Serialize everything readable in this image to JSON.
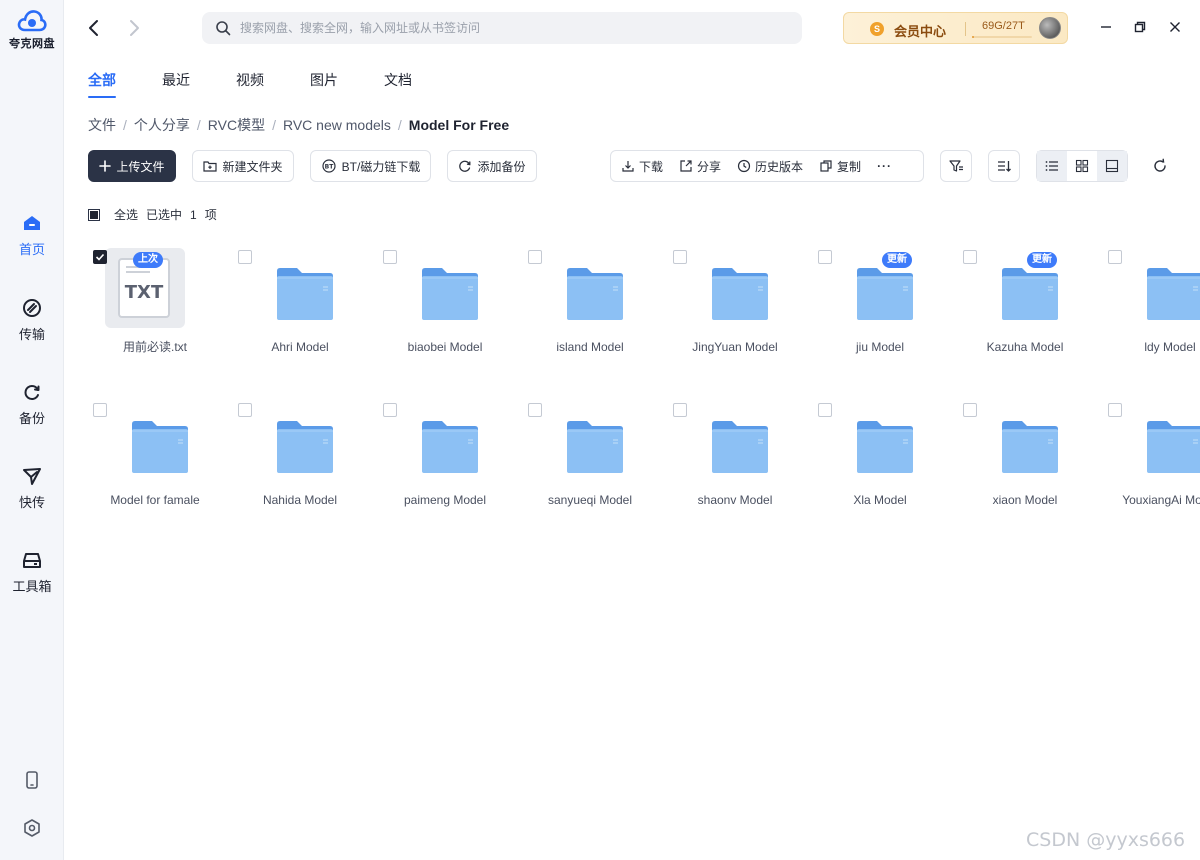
{
  "app": {
    "logo_text": "夸克网盘",
    "accent_color": "#2a6cf6"
  },
  "sidebar": {
    "items": [
      {
        "label": "首页",
        "icon": "home-icon",
        "active": true
      },
      {
        "label": "传输",
        "icon": "transfer-icon",
        "active": false
      },
      {
        "label": "备份",
        "icon": "backup-icon",
        "active": false
      },
      {
        "label": "快传",
        "icon": "quick-send-icon",
        "active": false
      },
      {
        "label": "工具箱",
        "icon": "toolbox-icon",
        "active": false
      }
    ],
    "bottom_icons": [
      "phone-icon",
      "settings-icon"
    ]
  },
  "topbar": {
    "search_placeholder": "搜索网盘、搜索全网，输入网址或从书签访问",
    "vip_label": "会员中心",
    "vip_coin": "S",
    "storage_text": "69G/27T",
    "storage_used_fraction": 0.0025
  },
  "tabs": [
    {
      "label": "全部",
      "active": true
    },
    {
      "label": "最近",
      "active": false
    },
    {
      "label": "视频",
      "active": false
    },
    {
      "label": "图片",
      "active": false
    },
    {
      "label": "文档",
      "active": false
    }
  ],
  "breadcrumb": {
    "items": [
      "文件",
      "个人分享",
      "RVC模型",
      "RVC new models"
    ],
    "current": "Model For Free",
    "separator": "/"
  },
  "toolbar": {
    "upload": "上传文件",
    "new_folder": "新建文件夹",
    "bt_download": "BT/磁力链下载",
    "add_backup": "添加备份",
    "download": "下载",
    "share": "分享",
    "history": "历史版本",
    "copy": "复制",
    "more": "···"
  },
  "selection": {
    "select_all": "全选",
    "selected_prefix": "已选中",
    "selected_count": "1",
    "selected_suffix": "项"
  },
  "files": [
    {
      "name": "用前必读.txt",
      "type": "txt",
      "thumb_label": "TXT",
      "checked": true,
      "badge": "上次"
    },
    {
      "name": "Ahri Model",
      "type": "folder",
      "checked": false,
      "badge": ""
    },
    {
      "name": "biaobei Model",
      "type": "folder",
      "checked": false,
      "badge": ""
    },
    {
      "name": "island Model",
      "type": "folder",
      "checked": false,
      "badge": ""
    },
    {
      "name": "JingYuan Model",
      "type": "folder",
      "checked": false,
      "badge": ""
    },
    {
      "name": "jiu Model",
      "type": "folder",
      "checked": false,
      "badge": "更新"
    },
    {
      "name": "Kazuha Model",
      "type": "folder",
      "checked": false,
      "badge": "更新"
    },
    {
      "name": "ldy Model",
      "type": "folder",
      "checked": false,
      "badge": ""
    },
    {
      "name": "Model for famale",
      "type": "folder",
      "checked": false,
      "badge": ""
    },
    {
      "name": "Nahida Model",
      "type": "folder",
      "checked": false,
      "badge": ""
    },
    {
      "name": "paimeng Model",
      "type": "folder",
      "checked": false,
      "badge": ""
    },
    {
      "name": "sanyueqi Model",
      "type": "folder",
      "checked": false,
      "badge": ""
    },
    {
      "name": "shaonv Model",
      "type": "folder",
      "checked": false,
      "badge": ""
    },
    {
      "name": "Xla Model",
      "type": "folder",
      "checked": false,
      "badge": ""
    },
    {
      "name": "xiaon Model",
      "type": "folder",
      "checked": false,
      "badge": ""
    },
    {
      "name": "YouxiangAi Model",
      "type": "folder",
      "checked": false,
      "badge": ""
    }
  ],
  "watermark": "CSDN @yyxs666"
}
